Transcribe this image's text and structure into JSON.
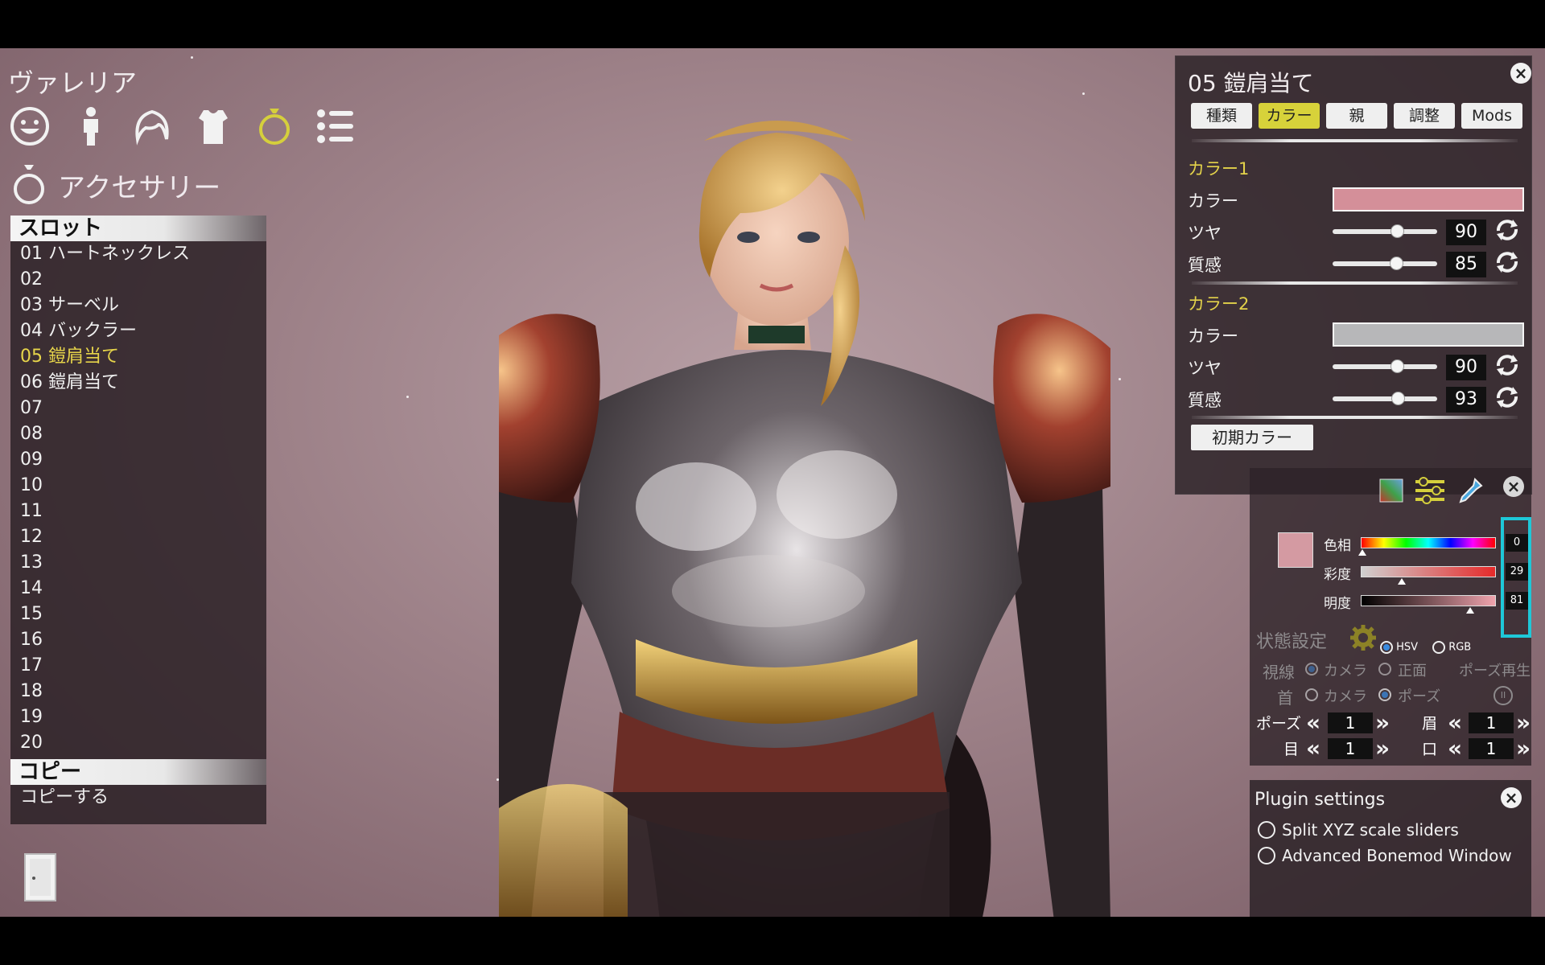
{
  "character_name": "ヴァレリア",
  "category_icons": [
    "face-icon",
    "body-icon",
    "hair-icon",
    "clothes-icon",
    "ring-icon",
    "list-icon"
  ],
  "active_category": "ring-icon",
  "section": {
    "label": "アクセサリー"
  },
  "slot_panel": {
    "header": "スロット",
    "items": [
      "01 ハートネックレス",
      "02",
      "03 サーベル",
      "04 バックラー",
      "05 鎧肩当て",
      "06 鎧肩当て",
      "07",
      "08",
      "09",
      "10",
      "11",
      "12",
      "13",
      "14",
      "15",
      "16",
      "17",
      "18",
      "19",
      "20"
    ],
    "active_index": 4,
    "copy_header": "コピー",
    "copy_action": "コピーする"
  },
  "accessory_panel": {
    "title": "05 鎧肩当て",
    "tabs": [
      "種類",
      "カラー",
      "親",
      "調整",
      "Mods"
    ],
    "active_tab": "カラー",
    "color1": {
      "section": "カラー1",
      "color_label": "カラー",
      "color_value": "#d48f99",
      "gloss_label": "ツヤ",
      "gloss_value": "90",
      "texture_label": "質感",
      "texture_value": "85"
    },
    "color2": {
      "section": "カラー2",
      "color_label": "カラー",
      "color_value": "#b7b7b9",
      "gloss_label": "ツヤ",
      "gloss_value": "90",
      "texture_label": "質感",
      "texture_value": "93"
    },
    "default_color_button": "初期カラー"
  },
  "color_picker": {
    "swatch": "#d49aa2",
    "hue_label": "色相",
    "hue_value": "0",
    "sat_label": "彩度",
    "sat_value": "29",
    "val_label": "明度",
    "val_value": "81",
    "mode_hsv": "HSV",
    "mode_rgb": "RGB",
    "selected_mode": "HSV",
    "highlight_color": "#1ec8d8"
  },
  "state_settings": {
    "title": "状態設定",
    "gaze_label": "視線",
    "neck_label": "首",
    "camera_label": "カメラ",
    "front_label": "正面",
    "pose_label": "ポーズ",
    "pose_play_label": "ポーズ再生",
    "pose_row_label": "ポーズ",
    "pose_value": "1",
    "eyebrow_label": "眉",
    "eyebrow_value": "1",
    "eye_label": "目",
    "eye_value": "1",
    "mouth_label": "口",
    "mouth_value": "1"
  },
  "plugin_settings": {
    "title": "Plugin settings",
    "options": [
      "Split XYZ scale sliders",
      "Advanced Bonemod Window"
    ]
  }
}
